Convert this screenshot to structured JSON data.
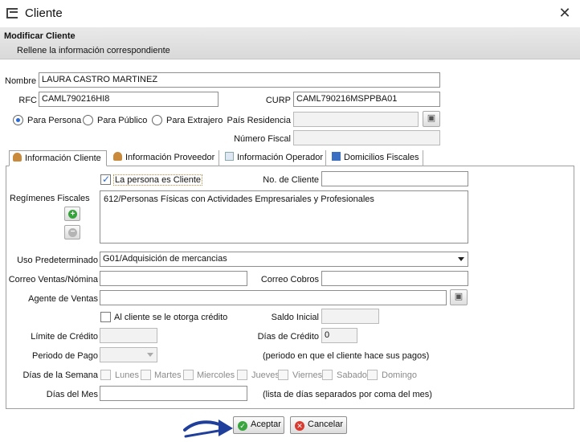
{
  "window": {
    "title": "Cliente",
    "close": "✕"
  },
  "header": {
    "title": "Modificar Cliente",
    "subtitle": "Rellene la información correspondiente"
  },
  "form": {
    "nombre_label": "Nombre",
    "nombre_value": "LAURA CASTRO MARTINEZ",
    "rfc_label": "RFC",
    "rfc_value": "CAML790216HI8",
    "curp_label": "CURP",
    "curp_value": "CAML790216MSPPBA01",
    "tipo_options": [
      "Para Persona",
      "Para Público",
      "Para Extrajero"
    ],
    "tipo_selected": "Para Persona",
    "pais_label": "País Residencia",
    "pais_value": "",
    "numfiscal_label": "Número Fiscal",
    "numfiscal_value": ""
  },
  "tabs": [
    {
      "label": "Información Cliente",
      "active": true
    },
    {
      "label": "Información Proveedor",
      "active": false
    },
    {
      "label": "Información Operador",
      "active": false
    },
    {
      "label": "Domicilios Fiscales",
      "active": false
    }
  ],
  "cliente": {
    "es_cliente_label": "La persona es Cliente",
    "es_cliente_checked": true,
    "no_cliente_label": "No. de Cliente",
    "no_cliente_value": "",
    "regimenes_label": "Regímenes Fiscales",
    "regimenes": [
      "612/Personas Físicas con Actividades Empresariales y Profesionales"
    ],
    "uso_label": "Uso Predeterminado",
    "uso_value": "G01/Adquisición de mercancias",
    "correo_ventas_label": "Correo Ventas/Nómina",
    "correo_ventas_value": "",
    "correo_cobros_label": "Correo Cobros",
    "correo_cobros_value": "",
    "agente_label": "Agente de Ventas",
    "agente_value": "",
    "credito_label": "Al cliente se le otorga crédito",
    "credito_checked": false,
    "saldo_label": "Saldo Inicial",
    "saldo_value": "",
    "limite_label": "Límite de Crédito",
    "limite_value": "",
    "dias_credito_label": "Días de Crédito",
    "dias_credito_value": "0",
    "periodo_label": "Periodo de Pago",
    "periodo_value": "",
    "periodo_hint": "(periodo en que el cliente hace sus pagos)",
    "dias_semana_label": "Días de la Semana",
    "dias_semana": [
      "Lunes",
      "Martes",
      "Miercoles",
      "Jueves",
      "Viernes",
      "Sabado",
      "Domingo"
    ],
    "dias_mes_label": "Días del Mes",
    "dias_mes_value": "",
    "dias_mes_hint": "(lista de días separados por coma del mes)"
  },
  "footer": {
    "accept_label": "Aceptar",
    "cancel_label": "Cancelar"
  },
  "colors": {
    "accept_icon": "#3aa43f",
    "cancel_icon": "#d93a2f",
    "arrow": "#1f3f9a",
    "radio_accent": "#2a6ad8"
  }
}
